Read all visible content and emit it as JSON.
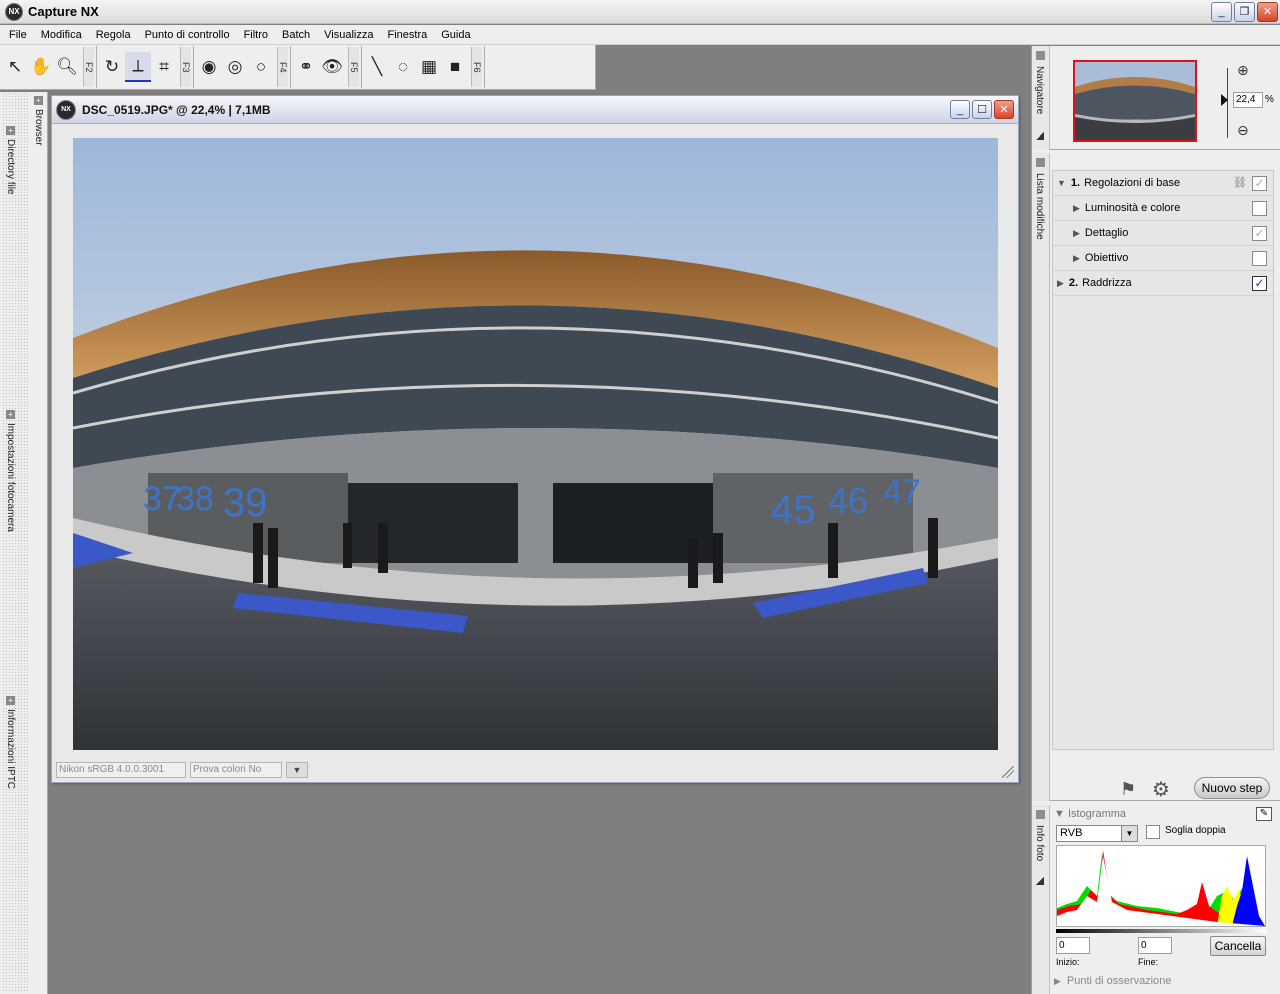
{
  "app": {
    "title": "Capture NX",
    "logo_text": "NX"
  },
  "window_controls": {
    "minimize": "_",
    "restore": "❐",
    "close": "✕"
  },
  "menu": [
    "File",
    "Modifica",
    "Regola",
    "Punto di controllo",
    "Filtro",
    "Batch",
    "Visualizza",
    "Finestra",
    "Guida"
  ],
  "toolbar": {
    "fkeys": [
      "F2",
      "F3",
      "F4",
      "F5",
      "F6"
    ]
  },
  "left_dock": {
    "tabs": [
      "Browser",
      "Directory file",
      "Impostazioni fotocamera",
      "Informazioni IPTC"
    ]
  },
  "document": {
    "title": "DSC_0519.JPG* @ 22,4% | 7,1MB",
    "logo_text": "NX",
    "status_profile": "Nikon sRGB 4.0.0.3001",
    "status_proof": "Prova colori No",
    "photo_numbers": [
      "37",
      "38",
      "39",
      "45",
      "46",
      "47"
    ]
  },
  "navigator": {
    "label": "Navigatore",
    "zoom_value": "22,4",
    "zoom_unit": "%"
  },
  "edit_list": {
    "label": "Lista modifiche",
    "items": [
      {
        "num": "1.",
        "label": "Regolazioni di base",
        "level": "main",
        "checked": true,
        "expanded": true
      },
      {
        "num": "",
        "label": "Luminosità e colore",
        "level": "sub",
        "checked": false
      },
      {
        "num": "",
        "label": "Dettaglio",
        "level": "sub",
        "checked": true
      },
      {
        "num": "",
        "label": "Obiettivo",
        "level": "sub",
        "checked": false
      },
      {
        "num": "2.",
        "label": "Raddrizza",
        "level": "main",
        "checked": true,
        "active": true
      }
    ],
    "new_step_label": "Nuovo step"
  },
  "histogram": {
    "side_label": "Info foto",
    "title": "Istogramma",
    "channel": "RVB",
    "double_threshold_label": "Soglia doppia",
    "start_value": "0",
    "end_value": "0",
    "start_label": "Inizio:",
    "end_label": "Fine:",
    "cancel_label": "Cancella",
    "punti_label": "Punti di osservazione",
    "colors": {
      "red": "#ff0000",
      "green": "#00dd00",
      "blue": "#0000ff",
      "yellow": "#ffff00"
    }
  }
}
